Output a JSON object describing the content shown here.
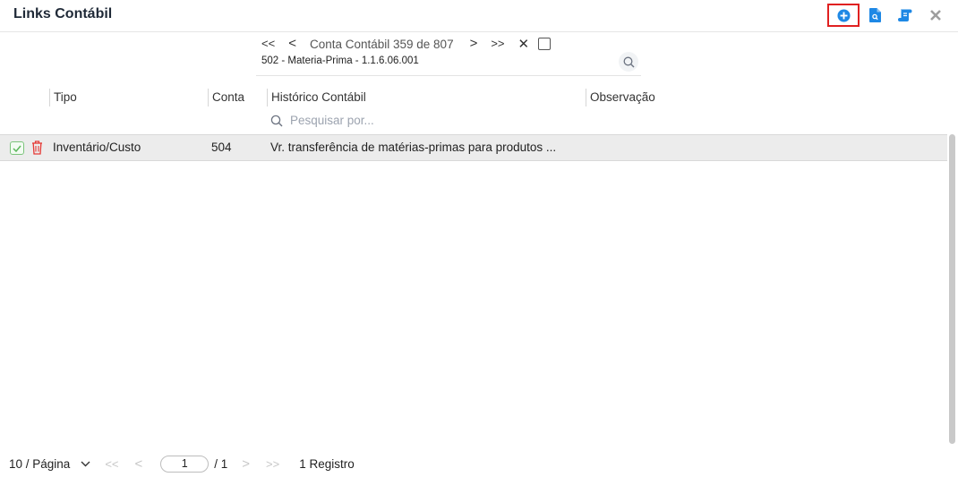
{
  "header": {
    "title": "Links Contábil",
    "icons": [
      "add-circle-icon",
      "document-search-icon",
      "scroll-icon",
      "close-icon"
    ],
    "accent": "#1e88e5",
    "highlight": "#e02020"
  },
  "account_nav": {
    "first": "<<",
    "prev": "<",
    "counter": "Conta Contábil 359 de 807",
    "next": ">",
    "last": ">>",
    "clear": "✕",
    "account_label": "502 - Materia-Prima - 1.1.6.06.001"
  },
  "table": {
    "columns": [
      "Tipo",
      "Conta",
      "Histórico Contábil",
      "Observação"
    ],
    "search_placeholder": "Pesquisar por...",
    "rows": [
      {
        "tipo": "Inventário/Custo",
        "conta": "504",
        "historico": "Vr. transferência de matérias-primas para produtos ...",
        "observacao": ""
      }
    ]
  },
  "pager": {
    "page_size": "10 / Página",
    "first": "<<",
    "prev": "<",
    "current_page": "1",
    "total_pages": "/ 1",
    "next": ">",
    "last": ">>",
    "record_count": "1 Registro"
  }
}
